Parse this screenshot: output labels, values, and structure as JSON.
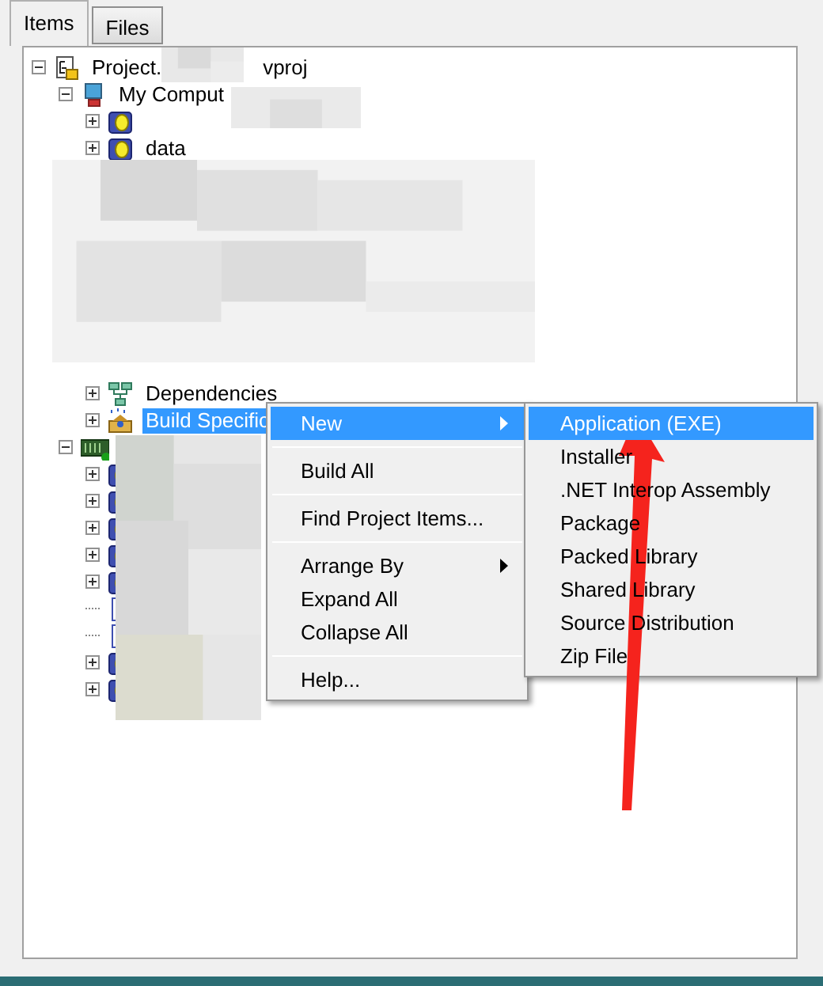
{
  "tabs": [
    {
      "label": "Items",
      "selected": true
    },
    {
      "label": "Files",
      "selected": false
    }
  ],
  "tree": [
    {
      "label": "Project.",
      "label_end": "vproj",
      "kind": "project",
      "expanded": true,
      "children": [
        {
          "label": "My Comput",
          "kind": "computer",
          "expanded": true,
          "children": [
            {
              "kind": "folder",
              "expanded": false
            },
            {
              "label": "data",
              "kind": "folder",
              "expanded": false
            },
            {
              "kind": "picture"
            },
            {
              "label": "Dependencies",
              "kind": "dependencies",
              "expanded": false
            },
            {
              "label": "Build Specific",
              "kind": "build",
              "expanded": false,
              "selected": true
            }
          ]
        },
        {
          "kind": "target",
          "expanded": true,
          "children": [
            {
              "kind": "folder",
              "expanded": false
            },
            {
              "kind": "folder",
              "expanded": false
            },
            {
              "kind": "folder",
              "expanded": false
            },
            {
              "kind": "folder",
              "expanded": false
            },
            {
              "kind": "folder",
              "expanded": false
            },
            {
              "kind": "file"
            },
            {
              "kind": "file"
            },
            {
              "kind": "folder",
              "expanded": false
            },
            {
              "kind": "folder",
              "expanded": false
            }
          ]
        }
      ]
    }
  ],
  "context_menu": [
    {
      "kind": "item",
      "label": "New",
      "submenu": true,
      "selected": true
    },
    {
      "kind": "separator"
    },
    {
      "kind": "item",
      "label": "Build All",
      "submenu": false,
      "selected": false
    },
    {
      "kind": "separator"
    },
    {
      "kind": "item",
      "label": "Find Project Items...",
      "submenu": false,
      "selected": false
    },
    {
      "kind": "separator"
    },
    {
      "kind": "item",
      "label": "Arrange By",
      "submenu": true,
      "selected": false
    },
    {
      "kind": "item",
      "label": "Expand All",
      "submenu": false,
      "selected": false
    },
    {
      "kind": "item",
      "label": "Collapse All",
      "submenu": false,
      "selected": false
    },
    {
      "kind": "separator"
    },
    {
      "kind": "item",
      "label": "Help...",
      "submenu": false,
      "selected": false
    }
  ],
  "submenu": [
    {
      "label": "Application (EXE)",
      "selected": true
    },
    {
      "label": "Installer",
      "selected": false
    },
    {
      "label": ".NET Interop Assembly",
      "selected": false
    },
    {
      "label": "Package",
      "selected": false
    },
    {
      "label": "Packed Library",
      "selected": false
    },
    {
      "label": "Shared Library",
      "selected": false
    },
    {
      "label": "Source Distribution",
      "selected": false
    },
    {
      "label": "Zip File",
      "selected": false
    }
  ]
}
